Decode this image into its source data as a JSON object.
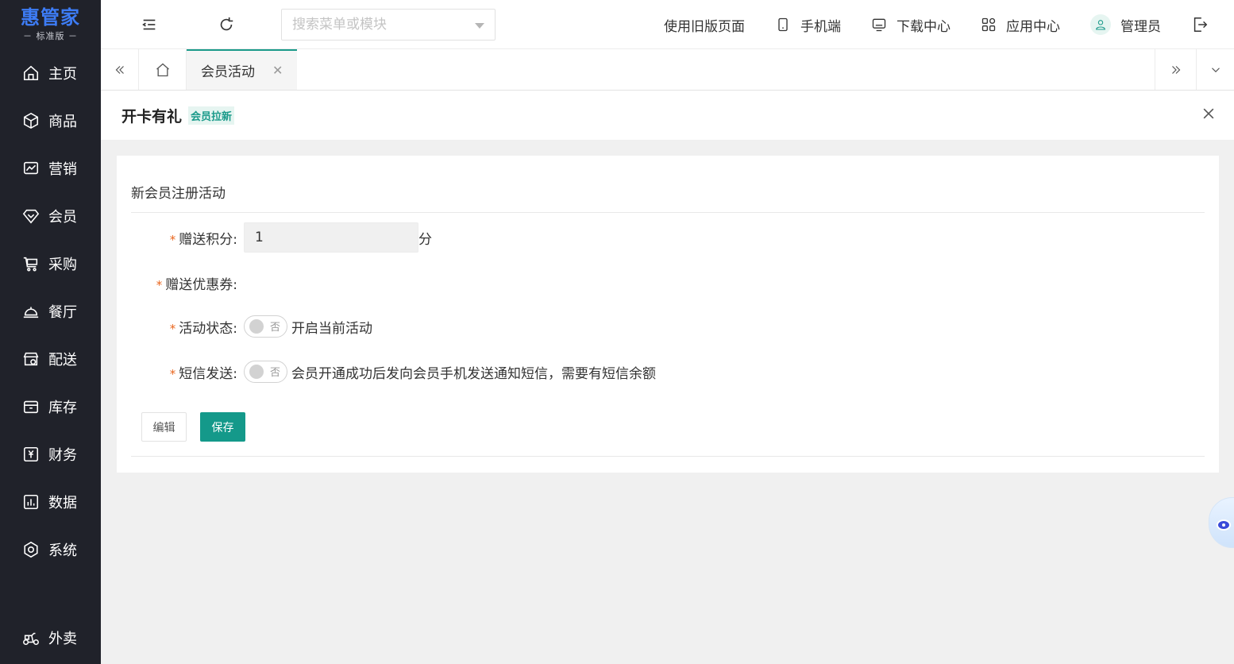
{
  "brand": {
    "title": "惠管家",
    "subtitle": "－ 标准版 －"
  },
  "sidebar": {
    "items": [
      {
        "label": "主页",
        "icon": "home-icon"
      },
      {
        "label": "商品",
        "icon": "cube-icon"
      },
      {
        "label": "营销",
        "icon": "chart-line-icon"
      },
      {
        "label": "会员",
        "icon": "diamond-icon"
      },
      {
        "label": "采购",
        "icon": "cart-icon"
      },
      {
        "label": "餐厅",
        "icon": "bell-icon"
      },
      {
        "label": "配送",
        "icon": "store-icon"
      },
      {
        "label": "库存",
        "icon": "box-icon"
      },
      {
        "label": "财务",
        "icon": "yen-icon"
      },
      {
        "label": "数据",
        "icon": "bar-chart-icon"
      },
      {
        "label": "系统",
        "icon": "gear-icon"
      }
    ],
    "bottom_item": {
      "label": "外卖",
      "icon": "scooter-icon"
    }
  },
  "header": {
    "search_placeholder": "搜索菜单或模块",
    "links": {
      "old_version": "使用旧版页面",
      "mobile": "手机端",
      "download": "下载中心",
      "apps": "应用中心",
      "user": "管理员"
    }
  },
  "tabs": {
    "active_label": "会员活动"
  },
  "page": {
    "title": "开卡有礼",
    "tag": "会员拉新"
  },
  "card": {
    "title": "新会员注册活动",
    "fields": {
      "points_label": "赠送积分:",
      "points_value": "1",
      "points_unit": "分",
      "coupon_label": "赠送优惠券:",
      "status_label": "活动状态:",
      "status_toggle": "否",
      "status_desc": "开启当前活动",
      "sms_label": "短信发送:",
      "sms_toggle": "否",
      "sms_desc": "会员开通成功后发向会员手机发送通知短信，需要有短信余额"
    },
    "buttons": {
      "edit": "编辑",
      "save": "保存"
    }
  },
  "colors": {
    "accent": "#14998a",
    "sidebar_bg": "#20222a",
    "brand_blue": "#3d7cf5",
    "required": "#e9661e"
  }
}
